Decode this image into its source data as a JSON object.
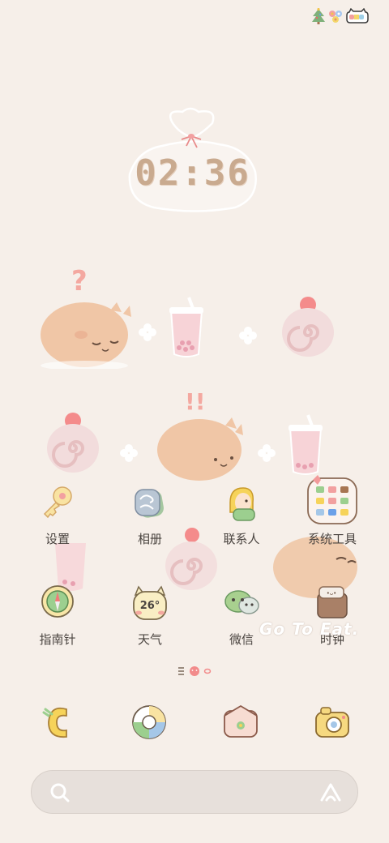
{
  "clock": {
    "time": "02:36"
  },
  "apps": [
    {
      "label": "设置",
      "icon": "settings-icon"
    },
    {
      "label": "相册",
      "icon": "gallery-icon"
    },
    {
      "label": "联系人",
      "icon": "contacts-icon"
    },
    {
      "label": "系统工具",
      "icon": "system-tools-folder-icon"
    },
    {
      "label": "指南针",
      "icon": "compass-icon"
    },
    {
      "label": "天气",
      "icon": "weather-icon",
      "badge": "26°"
    },
    {
      "label": "微信",
      "icon": "wechat-icon"
    },
    {
      "label": "时钟",
      "icon": "clock-icon"
    }
  ],
  "dock": [
    {
      "icon": "phone-icon"
    },
    {
      "icon": "browser-icon"
    },
    {
      "icon": "messages-icon"
    },
    {
      "icon": "camera-icon"
    }
  ],
  "wallpaper_text": "Go To Eat.",
  "colors": {
    "background": "#f6efe9",
    "bun": "#f0c6a6",
    "pink": "#f2a0a0"
  }
}
